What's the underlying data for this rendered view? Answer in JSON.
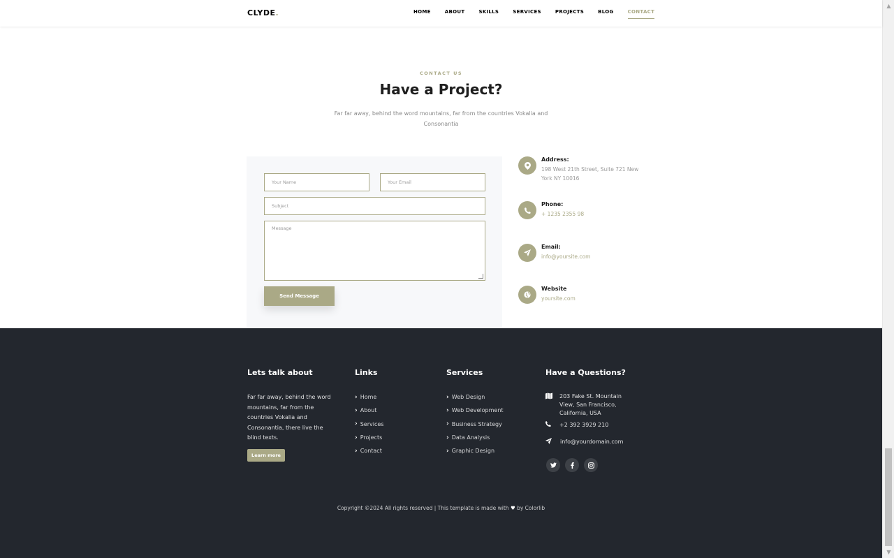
{
  "navbar": {
    "brand": "CLYDE",
    "brand_dot": ".",
    "items": [
      "HOME",
      "ABOUT",
      "SKILLS",
      "SERVICES",
      "PROJECTS",
      "BLOG",
      "CONTACT"
    ],
    "active": "CONTACT"
  },
  "contact": {
    "subheading": "CONTACT US",
    "heading": "Have a Project?",
    "lead": "Far far away, behind the word mountains, far from the countries Vokalia and Consonantia"
  },
  "form": {
    "name_placeholder": "Your Name",
    "email_placeholder": "Your Email",
    "subject_placeholder": "Subject",
    "message_placeholder": "Message",
    "send_label": "Send Message"
  },
  "info": {
    "address_title": "Address:",
    "address_text": "198 West 21th Street, Suite 721 New York NY 10016",
    "phone_title": "Phone:",
    "phone_text": "+ 1235 2355 98",
    "email_title": "Email:",
    "email_text": "info@yoursite.com",
    "website_title": "Website",
    "website_text": "yoursite.com"
  },
  "footer": {
    "about_title": "Lets talk about",
    "about_text": "Far far away, behind the word mountains, far from the countries Vokalia and Consonantia, there live the blind texts.",
    "learn_more": "Learn more",
    "links_title": "Links",
    "links": [
      "Home",
      "About",
      "Services",
      "Projects",
      "Contact"
    ],
    "services_title": "Services",
    "services": [
      "Web Design",
      "Web Development",
      "Business Strategy",
      "Data Analysis",
      "Graphic Design"
    ],
    "questions_title": "Have a Questions?",
    "q_address": "203 Fake St. Mountain View, San Francisco, California, USA",
    "q_phone": "+2 392 3929 210",
    "q_email": "info@yourdomain.com",
    "social": [
      "twitter-icon",
      "facebook-icon",
      "instagram-icon"
    ],
    "copyright_pre": "Copyright ©2024 All rights reserved | This template is made with",
    "copyright_post": "by Colorlib"
  },
  "colors": {
    "accent": "#aaa986",
    "footer_bg": "#23272e"
  }
}
